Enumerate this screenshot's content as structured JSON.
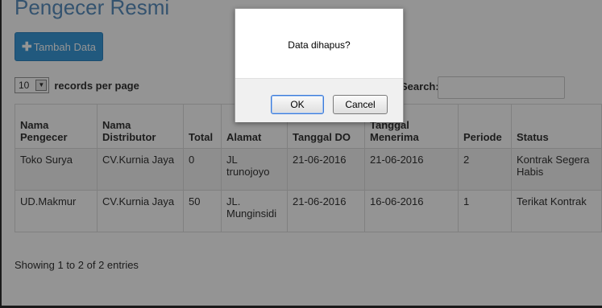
{
  "page": {
    "title": "Pengecer Resmi",
    "add_button": "Tambah Data"
  },
  "table_controls": {
    "length_value": "10",
    "records_per_page_label": "records per page",
    "search_label": "Search:"
  },
  "table": {
    "columns": [
      "Nama Pengecer",
      "Nama Distributor",
      "Total",
      "Alamat",
      "Tanggal DO",
      "Tanggal Menerima",
      "Periode",
      "Status"
    ],
    "rows": [
      [
        "Toko Surya",
        "CV.Kurnia Jaya",
        "0",
        "JL trunojoyo",
        "21-06-2016",
        "21-06-2016",
        "2",
        "Kontrak Segera Habis"
      ],
      [
        "UD.Makmur",
        "CV.Kurnia Jaya",
        "50",
        "JL. Munginsidi",
        "21-06-2016",
        "16-06-2016",
        "1",
        "Terikat Kontrak"
      ]
    ]
  },
  "info_text": "Showing 1 to 2 of 2 entries",
  "dialog": {
    "message": "Data dihapus?",
    "ok_label": "OK",
    "cancel_label": "Cancel"
  },
  "colors": {
    "title": "#5b8fbf",
    "primary_button": "#3a9ad9",
    "overlay": "rgba(0,0,0,0.42)"
  },
  "icons": {
    "add_button_icon": "plus-icon",
    "length_dropdown_icon": "chevron-down-icon"
  }
}
